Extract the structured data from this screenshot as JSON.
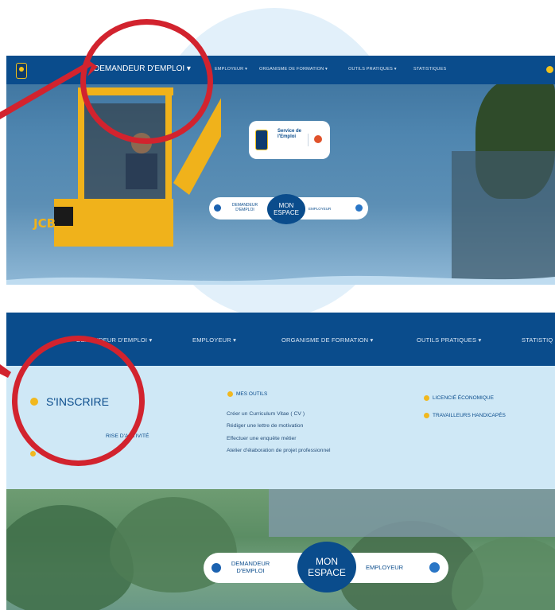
{
  "colors": {
    "nav": "#0a4c8c",
    "menu_bg": "#cfe8f6",
    "accent_yellow": "#f1b81f",
    "annotation_red": "#d2232e"
  },
  "top": {
    "nav": {
      "active_label": "DEMANDEUR D'EMPLOI ▾",
      "items": [
        "EMPLOYEUR ▾",
        "ORGANISME DE FORMATION ▾",
        "OUTILS PRATIQUES ▾",
        "STATISTIQUES"
      ]
    },
    "service_card": {
      "title_line1": "Service de",
      "title_line2": "l'Emploi",
      "icon": "service-emploi-logo"
    },
    "espace": {
      "left_line1": "DEMANDEUR",
      "left_line2": "D'EMPLOI",
      "center_line1": "MON",
      "center_line2": "ESPACE",
      "right": "EMPLOYEUR"
    },
    "photo_text": "JCB"
  },
  "bottom": {
    "nav": {
      "items": [
        "DEMANDEUR D'EMPLOI ▾",
        "EMPLOYEUR ▾",
        "ORGANISME DE FORMATION ▾",
        "OUTILS PRATIQUES ▾",
        "STATISTIQ"
      ]
    },
    "menu": {
      "col1": {
        "main": "S'INSCRIRE",
        "secondary": "RISE D'ACTIVITÉ"
      },
      "col2": {
        "heading": "MES OUTILS",
        "links": [
          "Créer un Curriculum Vitae ( CV )",
          "Rédiger une lettre de motivation",
          "Effectuer une enquête métier",
          "Atelier d'élaboration de projet professionnel"
        ]
      },
      "col3": {
        "links": [
          "LICENCIÉ ÉCONOMIQUE",
          "TRAVAILLEURS HANDICAPÉS"
        ]
      }
    },
    "espace": {
      "left_line1": "DEMANDEUR",
      "left_line2": "D'EMPLOI",
      "center_line1": "MON",
      "center_line2": "ESPACE",
      "right": "EMPLOYEUR"
    }
  }
}
